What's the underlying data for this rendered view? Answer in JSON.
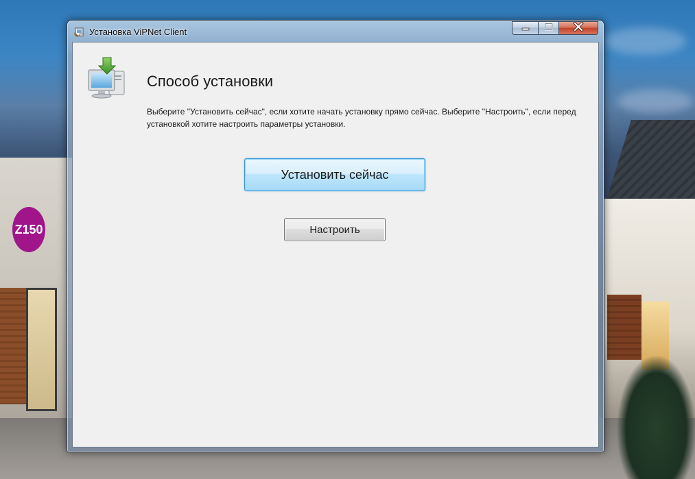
{
  "window": {
    "title": "Установка ViPNet Client",
    "controls": {
      "minimize": "minimize-icon",
      "maximize": "maximize-icon",
      "close": "close-icon"
    }
  },
  "page": {
    "title": "Способ установки",
    "description": "Выберите \"Установить сейчас\", если хотите начать установку прямо сейчас. Выберите \"Настроить\", если перед установкой хотите настроить параметры установки."
  },
  "buttons": {
    "install_now": "Установить сейчас",
    "configure": "Настроить"
  },
  "background": {
    "badge": "Z150"
  },
  "colors": {
    "accent_border": "#3c9ad9",
    "close_button": "#c2432a",
    "dialog_bg": "#f0f0f0"
  }
}
